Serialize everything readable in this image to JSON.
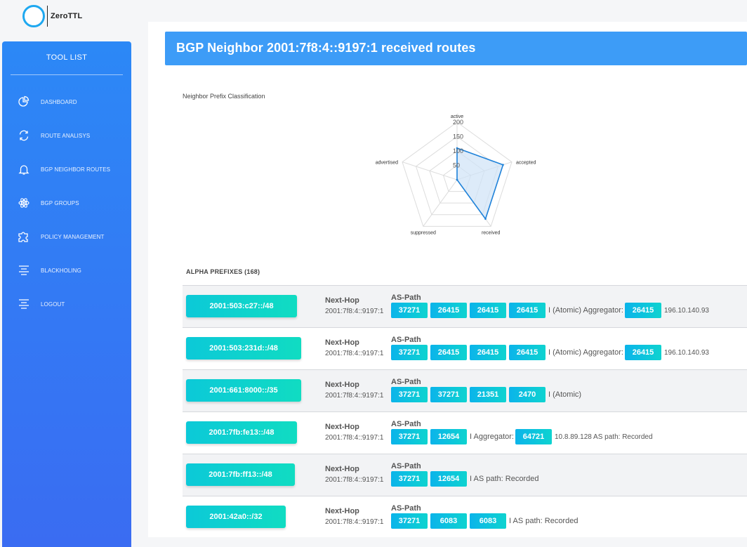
{
  "logo": {
    "text": "ZeroTTL"
  },
  "sidebar": {
    "title": "TOOL LIST",
    "items": [
      {
        "label": "DASHBOARD",
        "icon": "pie-chart-icon"
      },
      {
        "label": "ROUTE ANALISYS",
        "icon": "refresh-icon"
      },
      {
        "label": "BGP NEIGHBOR ROUTES",
        "icon": "bell-icon"
      },
      {
        "label": "BGP GROUPS",
        "icon": "atom-icon"
      },
      {
        "label": "POLICY MANAGEMENT",
        "icon": "puzzle-icon"
      },
      {
        "label": "BLACKHOLING",
        "icon": "align-center-icon"
      },
      {
        "label": "LOGOUT",
        "icon": "align-center-icon"
      }
    ]
  },
  "header": {
    "title": "BGP Neighbor 2001:7f8:4::9197:1 received routes"
  },
  "chart_data": {
    "type": "radar",
    "title": "Neighbor Prefix Classification",
    "axes": [
      "active",
      "accepted",
      "received",
      "suppressed",
      "advertised"
    ],
    "ticks": [
      "200",
      "150",
      "100",
      "50"
    ],
    "range": [
      0,
      200
    ],
    "values": [
      110,
      168,
      168,
      0,
      0
    ],
    "grid": true,
    "colors": {
      "line": "#1f82d9",
      "fill": "#cfe3f7"
    }
  },
  "section": {
    "title": "ALPHA PREFIXES (168)"
  },
  "labels": {
    "next_hop": "Next-Hop",
    "as_path": "AS-Path"
  },
  "colors": {
    "accent": "#3d9cf7",
    "badge": "#0bb4ea",
    "prefix": "#10dcc2"
  },
  "rows": [
    {
      "prefix": "2001:503:c27::/48",
      "next_hop": "2001:7f8:4::9197:1",
      "path": [
        {
          "t": "b",
          "v": "37271"
        },
        {
          "t": "b",
          "v": "26415"
        },
        {
          "t": "b",
          "v": "26415"
        },
        {
          "t": "b",
          "v": "26415"
        },
        {
          "t": "s",
          "v": "I (Atomic) Aggregator:"
        },
        {
          "t": "b",
          "v": "26415"
        },
        {
          "t": "m",
          "v": "196.10.140.93"
        }
      ]
    },
    {
      "prefix": "2001:503:231d::/48",
      "next_hop": "2001:7f8:4::9197:1",
      "path": [
        {
          "t": "b",
          "v": "37271"
        },
        {
          "t": "b",
          "v": "26415"
        },
        {
          "t": "b",
          "v": "26415"
        },
        {
          "t": "b",
          "v": "26415"
        },
        {
          "t": "s",
          "v": "I (Atomic) Aggregator:"
        },
        {
          "t": "b",
          "v": "26415"
        },
        {
          "t": "m",
          "v": "196.10.140.93"
        }
      ]
    },
    {
      "prefix": "2001:661:8000::/35",
      "next_hop": "2001:7f8:4::9197:1",
      "path": [
        {
          "t": "b",
          "v": "37271"
        },
        {
          "t": "b",
          "v": "37271"
        },
        {
          "t": "b",
          "v": "21351"
        },
        {
          "t": "b",
          "v": "2470"
        },
        {
          "t": "s",
          "v": "I (Atomic)"
        }
      ]
    },
    {
      "prefix": "2001:7fb:fe13::/48",
      "next_hop": "2001:7f8:4::9197:1",
      "path": [
        {
          "t": "b",
          "v": "37271"
        },
        {
          "t": "b",
          "v": "12654"
        },
        {
          "t": "s",
          "v": "I Aggregator:"
        },
        {
          "t": "b",
          "v": "64721"
        },
        {
          "t": "m",
          "v": "10.8.89.128 AS path: Recorded"
        }
      ]
    },
    {
      "prefix": "2001:7fb:ff13::/48",
      "next_hop": "2001:7f8:4::9197:1",
      "path": [
        {
          "t": "b",
          "v": "37271"
        },
        {
          "t": "b",
          "v": "12654"
        },
        {
          "t": "s",
          "v": "I AS path: Recorded"
        }
      ]
    },
    {
      "prefix": "2001:42a0::/32",
      "next_hop": "2001:7f8:4::9197:1",
      "path": [
        {
          "t": "b",
          "v": "37271"
        },
        {
          "t": "b",
          "v": "6083"
        },
        {
          "t": "b",
          "v": "6083"
        },
        {
          "t": "s",
          "v": "I AS path: Recorded"
        }
      ]
    }
  ]
}
